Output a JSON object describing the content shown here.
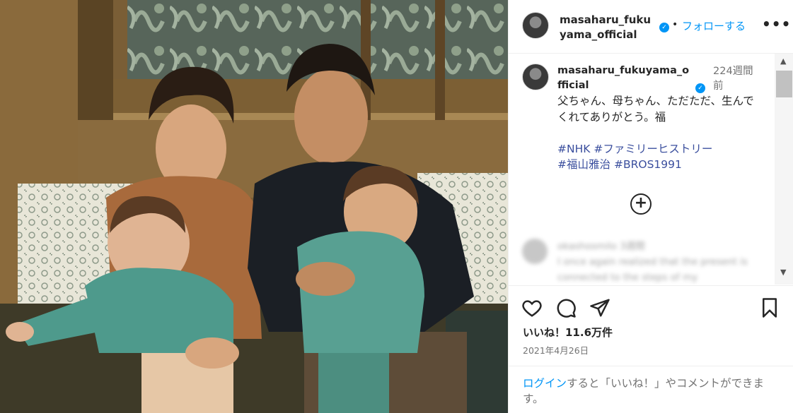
{
  "header": {
    "username": "masaharu_fukuyama_official",
    "follow_label": "フォローする",
    "more_label": "•••"
  },
  "caption": {
    "username": "masaharu_fukuyama_official",
    "time": "224週間前",
    "text": "父ちゃん、母ちゃん、ただただ、生んでくれてありがとう。福",
    "hashtags": [
      "#NHK",
      "#ファミリーヒストリー",
      "#福山雅治",
      "#BROS1991"
    ],
    "load_more_label": "+"
  },
  "blurred_comment": {
    "username": "okashosmilo 3週間",
    "text": "I once again realized that the present is connected to the steps of my"
  },
  "actions": {
    "likes": "いいね！11.6万件",
    "date": "2021年4月26日"
  },
  "login_prompt": {
    "link": "ログイン",
    "rest": "すると「いいね！」やコメントができます。"
  },
  "icons": [
    "heart-icon",
    "comment-icon",
    "share-icon",
    "bookmark-icon",
    "verified-icon",
    "more-icon",
    "add-circle-icon"
  ],
  "colors": {
    "accent": "#0095f6",
    "hashtag": "#3b4f9e",
    "muted": "#737373",
    "text": "#262626"
  }
}
